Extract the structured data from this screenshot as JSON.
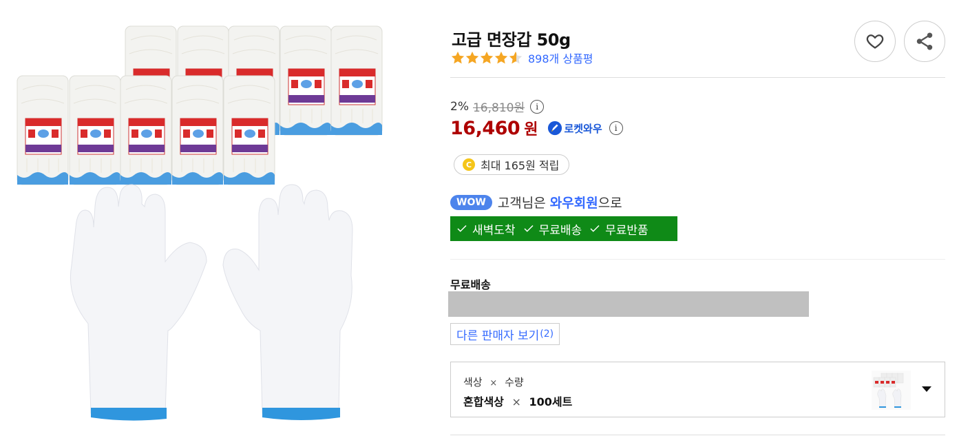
{
  "product": {
    "title": "고급 면장갑 50g",
    "rating": 4.5,
    "review_count_text": "898개 상품평"
  },
  "actions": {
    "favorite_icon": "heart-icon",
    "share_icon": "share-icon"
  },
  "price": {
    "discount_rate": "2%",
    "original_price": "16,810원",
    "sale_price": "16,460",
    "unit": "원",
    "rocket_badge": "로켓와우"
  },
  "cashback": {
    "coin_symbol": "C",
    "text": "최대 165원 적립"
  },
  "wow": {
    "badge": "WOW",
    "prefix": "고객님은 ",
    "highlight": "와우회원",
    "suffix": "으로",
    "benefits": [
      "새벽도착",
      "무료배송",
      "무료반품"
    ]
  },
  "shipping": {
    "label": "무료배송"
  },
  "sellers": {
    "label": "다른 판매자 보기",
    "count": "(2)"
  },
  "option": {
    "label_color": "색상",
    "label_sep": "×",
    "label_qty": "수량",
    "value_color": "혼합색상",
    "value_sep": "×",
    "value_qty": "100세트"
  },
  "colors": {
    "price_red": "#ae0000",
    "link_blue": "#346aff",
    "wow_green": "#0f8a17",
    "star_orange": "#f5a623"
  }
}
